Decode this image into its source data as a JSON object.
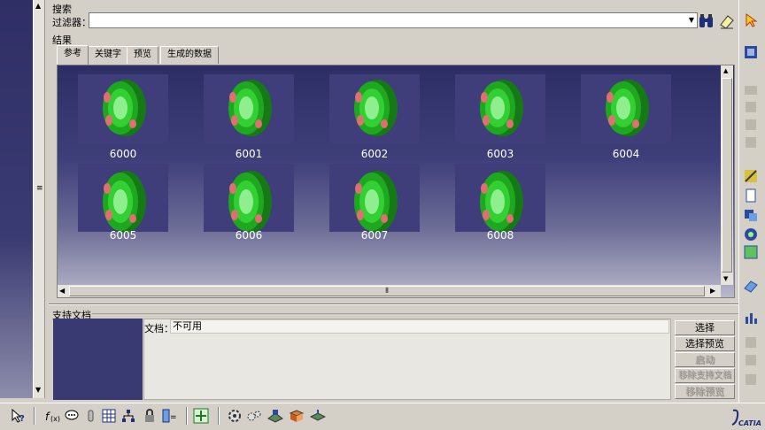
{
  "search": {
    "label": "搜索",
    "filter_label": "过滤器：",
    "filter_value": ""
  },
  "results": {
    "label": "结果",
    "tabs": [
      {
        "label": "参考"
      },
      {
        "label": "关键字"
      },
      {
        "label": "预览"
      },
      {
        "label": "生成的数据"
      }
    ],
    "items": [
      {
        "label": "6000"
      },
      {
        "label": "6001"
      },
      {
        "label": "6002"
      },
      {
        "label": "6003"
      },
      {
        "label": "6004"
      },
      {
        "label": "6005"
      },
      {
        "label": "6006"
      },
      {
        "label": "6007"
      },
      {
        "label": "6008"
      }
    ]
  },
  "support": {
    "label": "支持文档",
    "doc_label": "文档：",
    "doc_value": "不可用",
    "buttons": [
      {
        "label": "选择",
        "enabled": true
      },
      {
        "label": "选择预览",
        "enabled": true
      },
      {
        "label": "启动",
        "enabled": false
      },
      {
        "label": "移除支持文档",
        "enabled": false
      },
      {
        "label": "移除预览",
        "enabled": false
      }
    ]
  },
  "logo": {
    "text": "CATIA"
  },
  "colors": {
    "gallery_bg": "#2e2e66",
    "thumb_bg": "#3f3d7a",
    "part_green": "#1f9e1f"
  }
}
